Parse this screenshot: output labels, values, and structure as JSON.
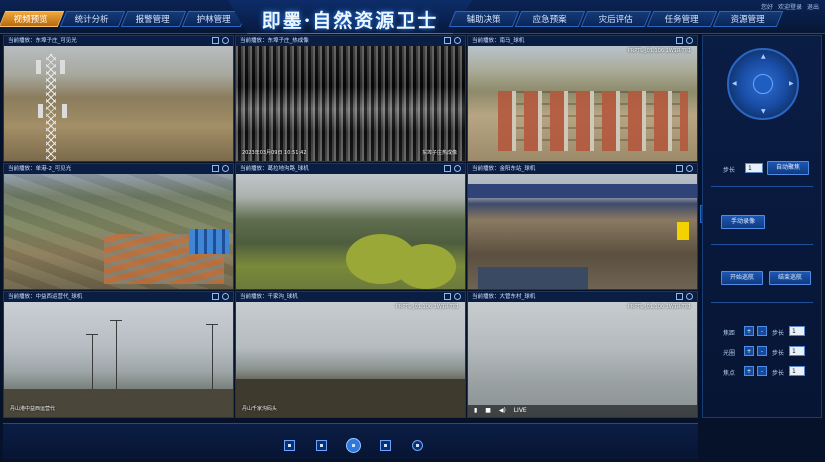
{
  "header": {
    "title": "即墨·自然资源卫士",
    "left_tabs": [
      {
        "label": "视频预览",
        "active": true
      },
      {
        "label": "统计分析",
        "active": false
      },
      {
        "label": "报警管理",
        "active": false
      },
      {
        "label": "护林管理",
        "active": false
      }
    ],
    "right_tabs": [
      {
        "label": "辅助决策"
      },
      {
        "label": "应急预案"
      },
      {
        "label": "灾后评估"
      },
      {
        "label": "任务管理"
      },
      {
        "label": "资源管理"
      }
    ],
    "user_links": [
      "您好",
      "欢迎登录",
      "退出"
    ]
  },
  "cells": [
    {
      "label": "当前播放：东埠子庄_可见光",
      "scene": "tower"
    },
    {
      "label": "当前播放：东埠子庄_热成像",
      "scene": "thermal",
      "osd_bottom_left": "2023年03月09日 10:51:42",
      "osd_bottom_right": "东埠子庄热成像"
    },
    {
      "label": "当前播放：南马_球机",
      "scene": "village",
      "osd_top_right": "PRPTL-J01,106 1W1R-T01"
    },
    {
      "label": "当前播放：单港-2_可见光",
      "scene": "farms"
    },
    {
      "label": "当前播放：葛拉地沟路_球机",
      "scene": "forest"
    },
    {
      "label": "当前播放：金阳东站_球机",
      "scene": "mine"
    },
    {
      "label": "当前播放：中益西运营代_球机",
      "scene": "coast1",
      "osd_bottom_left": "丹山港中益西运营代"
    },
    {
      "label": "当前播放：千家沟_球机",
      "scene": "coast2",
      "osd_top_right": "PRPTL-J01,106 1W1R-T01",
      "osd_bottom_left": "丹山千家沟码头"
    },
    {
      "label": "当前播放：大管东村_球机",
      "scene": "sea",
      "osd_top_right": "PRPTL-J01,106 1W1R-T01",
      "live_label": "LIVE"
    }
  ],
  "panel": {
    "ptz_arrows": {
      "up": "▲",
      "down": "▼",
      "left": "◀",
      "right": "▶"
    },
    "step_label": "步长",
    "step_value": "1",
    "auto_scan_label": "自动聚焦",
    "manual_record_label": "手动录像",
    "start_patrol_label": "开始巡航",
    "end_patrol_label": "结束巡航",
    "adjust_rows": [
      {
        "label": "焦距",
        "plus": "+",
        "minus": "-",
        "step_label": "步长",
        "value": "1"
      },
      {
        "label": "光圈",
        "plus": "+",
        "minus": "-",
        "step_label": "步长",
        "value": "1"
      },
      {
        "label": "焦点",
        "plus": "+",
        "minus": "-",
        "step_label": "步长",
        "value": "1"
      }
    ]
  },
  "bottom": {
    "layouts": [
      "1x1",
      "2x2",
      "3x3",
      "4x4",
      "fullscreen"
    ],
    "active_layout": "3x3"
  }
}
